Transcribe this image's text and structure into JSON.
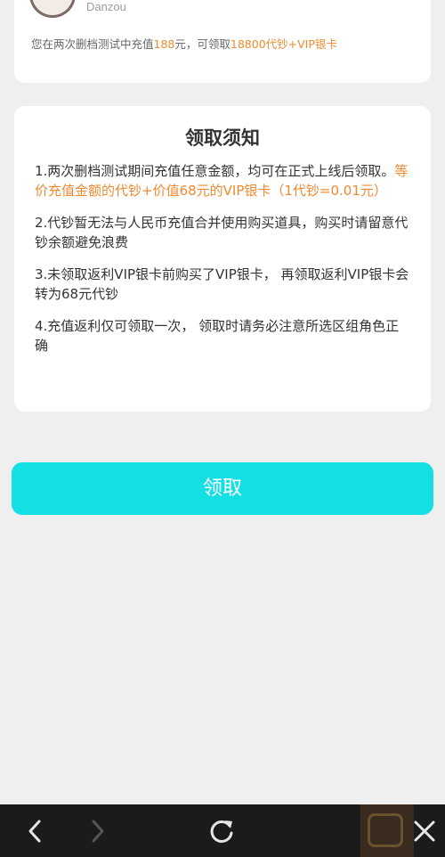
{
  "account": {
    "username": "Danzou",
    "info_prefix": "您在两次删档测试中充值",
    "recharge_amount": "188",
    "info_middle": "元，可领取",
    "reward": "18800代钞+VIP银卡"
  },
  "notice": {
    "title": "领取须知",
    "items": [
      {
        "text": "1.两次删档测试期间充值任意金额，均可在正式上线后领取。",
        "highlight": "等价充值金额的代钞+价值68元的VIP银卡（1代钞=0.01元）"
      },
      {
        "text": "2.代钞暂无法与人民币充值合并使用购买道具，购买时请留意代钞余额避免浪费"
      },
      {
        "text": "3.未领取返利VIP银卡前购买了VIP银卡， 再领取返利VIP银卡会转为68元代钞"
      },
      {
        "text": "4.充值返利仅可领取一次， 领取时请务必注意所选区组角色正确"
      }
    ]
  },
  "claim_button_label": "领取",
  "colors": {
    "accent": "#f08a32",
    "button": "#14e0e3",
    "background": "#efefef"
  },
  "nav": {
    "back_icon": "chevron-left-icon",
    "forward_icon": "chevron-right-icon",
    "refresh_icon": "refresh-icon",
    "close_icon": "close-icon"
  }
}
